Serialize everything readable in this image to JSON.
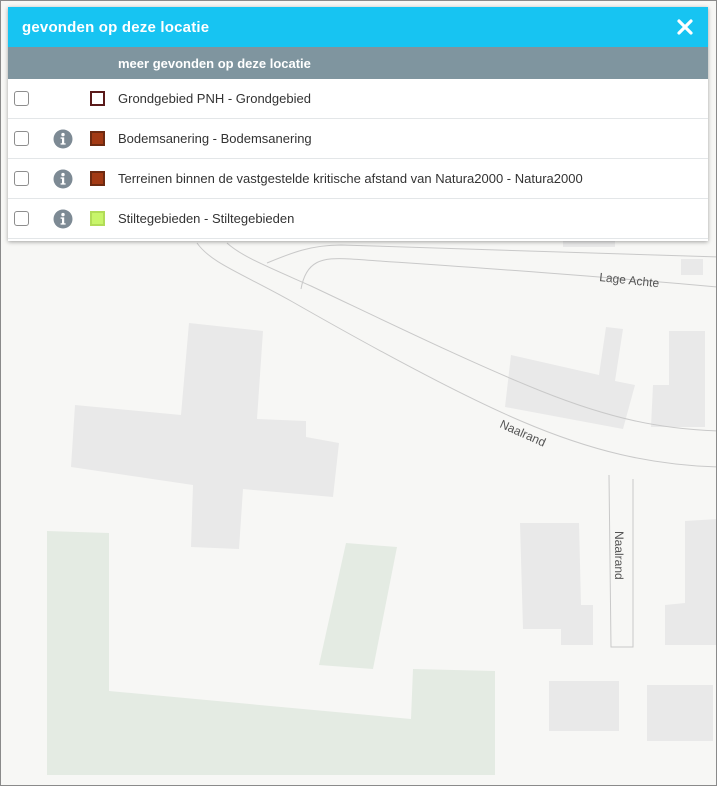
{
  "panel": {
    "title": "gevonden op deze locatie",
    "close_icon": "close-icon",
    "subheader": "meer gevonden op deze locatie",
    "rows": [
      {
        "label": "Grondgebied PNH - Grondgebied",
        "swatch_fill": "#ffffff",
        "swatch_border": "#5a1a1a",
        "has_info": false,
        "checked": false
      },
      {
        "label": "Bodemsanering - Bodemsanering",
        "swatch_fill": "#a33a14",
        "swatch_border": "#6e2a10",
        "has_info": true,
        "checked": false
      },
      {
        "label": "Terreinen binnen de vastgestelde kritische afstand van Natura2000 - Natura2000",
        "swatch_fill": "#a33a14",
        "swatch_border": "#6e2a10",
        "has_info": true,
        "checked": false
      },
      {
        "label": "Stiltegebieden - Stiltegebieden",
        "swatch_fill": "#c8f56a",
        "swatch_border": "#b2dc58",
        "has_info": true,
        "checked": false
      }
    ]
  },
  "map": {
    "street_labels": [
      "Lage Achte",
      "Naalrand",
      "Naalrand"
    ]
  },
  "colors": {
    "header": "#17c4f2",
    "subheader": "#7f959f",
    "building": "#e9e9e9",
    "green_area": "#e4ebe3",
    "road_outline": "#c9c9c9"
  }
}
